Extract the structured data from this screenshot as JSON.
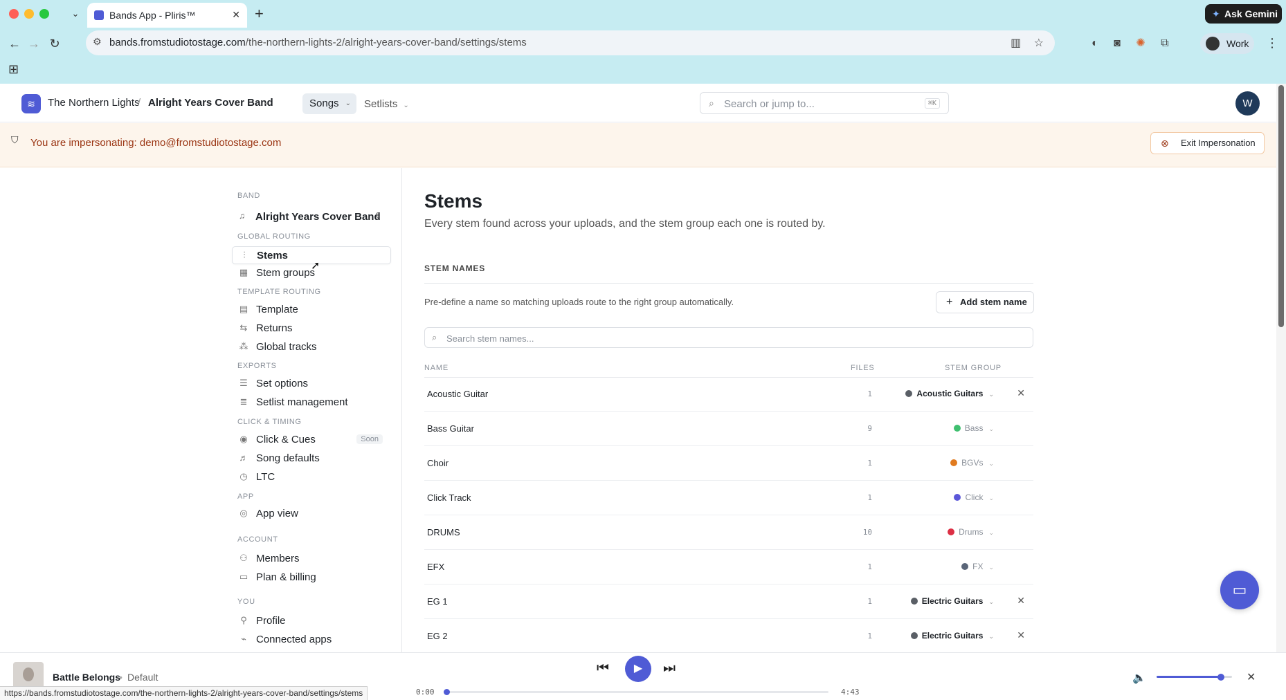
{
  "browser": {
    "tab_title": "Bands App - Pliris™",
    "new_tab": "+",
    "ask_gemini": "Ask Gemini",
    "url_host": "bands.fromstudiotostage.com",
    "url_path": "/the-northern-lights-2/alright-years-cover-band/settings/stems",
    "profile": "Work",
    "status_url": "https://bands.fromstudiotostage.com/the-northern-lights-2/alright-years-cover-band/settings/stems"
  },
  "header": {
    "org": "The Northern Lights",
    "separator": "/",
    "band": "Alright Years Cover Band",
    "nav_songs": "Songs",
    "nav_setlists": "Setlists",
    "search_placeholder": "Search or jump to...",
    "search_kbd": "⌘K",
    "avatar": "W"
  },
  "banner": {
    "text": "You are impersonating: demo@fromstudiotostage.com",
    "exit_label": "Exit Impersonation"
  },
  "sidebar": {
    "band_label": "BAND",
    "band_name": "Alright Years Cover Band",
    "sections": {
      "global_routing": "GLOBAL ROUTING",
      "template_routing": "TEMPLATE ROUTING",
      "exports": "EXPORTS",
      "click_timing": "CLICK & TIMING",
      "app": "APP",
      "account": "ACCOUNT",
      "you": "YOU"
    },
    "items": {
      "stems": "Stems",
      "stem_groups": "Stem groups",
      "template": "Template",
      "returns": "Returns",
      "global_tracks": "Global tracks",
      "set_options": "Set options",
      "setlist_management": "Setlist management",
      "click_cues": "Click & Cues",
      "soon": "Soon",
      "song_defaults": "Song defaults",
      "ltc": "LTC",
      "app_view": "App view",
      "members": "Members",
      "plan_billing": "Plan & billing",
      "profile": "Profile",
      "connected_apps": "Connected apps"
    }
  },
  "main": {
    "title": "Stems",
    "subtitle": "Every stem found across your uploads, and the stem group each one is routed by.",
    "section_title": "STEM NAMES",
    "description": "Pre-define a name so matching uploads route to the right group automatically.",
    "add_label": "Add stem name",
    "search_placeholder": "Search stem names...",
    "col_name": "NAME",
    "col_files": "FILES",
    "col_group": "STEM GROUP",
    "rows": [
      {
        "name": "Acoustic Guitar",
        "files": "1",
        "group": "Acoustic Guitars",
        "color": "#5a5f66",
        "style": "bold",
        "removable": true
      },
      {
        "name": "Bass Guitar",
        "files": "9",
        "group": "Bass",
        "color": "#3fbf6f",
        "style": "muted",
        "removable": false
      },
      {
        "name": "Choir",
        "files": "1",
        "group": "BGVs",
        "color": "#e07a1f",
        "style": "muted",
        "removable": false
      },
      {
        "name": "Click Track",
        "files": "1",
        "group": "Click",
        "color": "#5b57d9",
        "style": "muted",
        "removable": false
      },
      {
        "name": "DRUMS",
        "files": "10",
        "group": "Drums",
        "color": "#dc2f44",
        "style": "muted",
        "removable": false
      },
      {
        "name": "EFX",
        "files": "1",
        "group": "FX",
        "color": "#5a6578",
        "style": "muted",
        "removable": false
      },
      {
        "name": "EG 1",
        "files": "1",
        "group": "Electric Guitars",
        "color": "#5a5f66",
        "style": "bold",
        "removable": true
      },
      {
        "name": "EG 2",
        "files": "1",
        "group": "Electric Guitars",
        "color": "#5a5f66",
        "style": "bold",
        "removable": true
      }
    ]
  },
  "player": {
    "song": "Battle Belongs",
    "separator": "•",
    "version": "Default",
    "time_current": "0:00",
    "time_total": "4:43",
    "progress": 0.0,
    "volume": 0.85
  },
  "colors": {
    "accent": "#4f5bd5",
    "banner_text": "#9a3412"
  }
}
